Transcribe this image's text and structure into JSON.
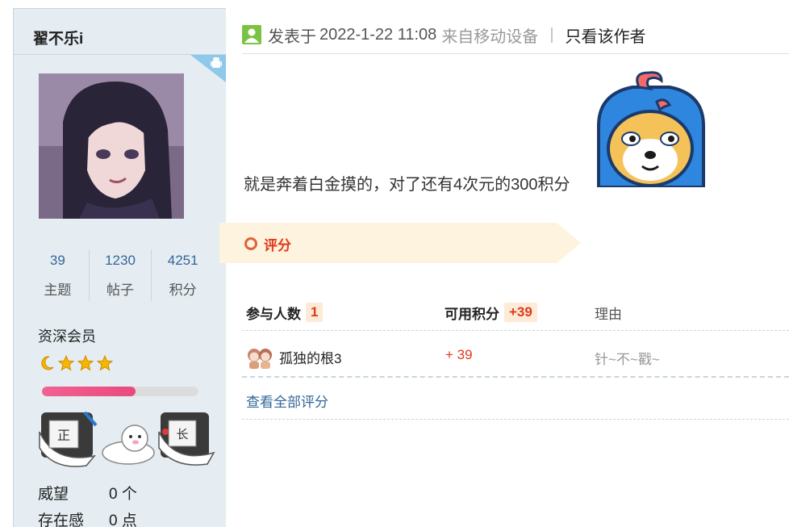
{
  "sidebar": {
    "username": "翟不乐i",
    "stats": [
      {
        "value": "39",
        "label": "主题"
      },
      {
        "value": "1230",
        "label": "帖子"
      },
      {
        "value": "4251",
        "label": "积分"
      }
    ],
    "group": "资深会员",
    "level_progress_percent": 60,
    "info": [
      {
        "label": "威望",
        "value": "0 个"
      },
      {
        "label": "存在感",
        "value": "0 点"
      }
    ],
    "colors": {
      "background": "#e5edf2",
      "link": "#336699",
      "progress": "#e94a7c"
    }
  },
  "post": {
    "posted_label": "发表于",
    "posted_time": "2022-1-22 11:08",
    "via": "来自移动设备",
    "separator": "|",
    "only_author": "只看该作者",
    "content": "就是奔着白金摸的，对了还有4次元的300积分"
  },
  "rating": {
    "title": "评分",
    "participants_label": "参与人数",
    "participants_count": "1",
    "points_label": "可用积分",
    "points_total": "+39",
    "reason_label": "理由",
    "rows": [
      {
        "name": "孤独的根3",
        "points": "+ 39",
        "reason": "针~不~戳~"
      }
    ],
    "view_all": "查看全部评分",
    "colors": {
      "accent": "#e03a1a",
      "banner": "#fdf3df"
    }
  }
}
